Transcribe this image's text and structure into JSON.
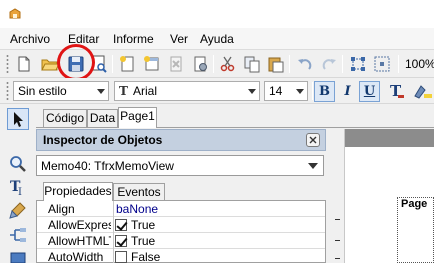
{
  "menu": [
    "Archivo",
    "Editar",
    "Informe",
    "Ver",
    "Ayuda"
  ],
  "toolbar": {
    "zoom": "100%",
    "style_combo": "Sin estilo",
    "font_combo": "Arial",
    "font_size": "14",
    "bold": "B",
    "italic": "I",
    "underline": "U"
  },
  "tabs": [
    "Código",
    "Data",
    "Page1"
  ],
  "inspector": {
    "title": "Inspector de Objetos",
    "object_selected": "Memo40: TfrxMemoView",
    "tabs": [
      "Propiedades",
      "Eventos"
    ],
    "properties": [
      {
        "name": "Align",
        "value": "baNone",
        "checkbox": null
      },
      {
        "name": "AllowExpressions",
        "value": "True",
        "checkbox": true
      },
      {
        "name": "AllowHTMLTags",
        "value": "True",
        "checkbox": true
      },
      {
        "name": "AutoWidth",
        "value": "False",
        "checkbox": false
      }
    ]
  },
  "designer": {
    "band_title": "Page"
  },
  "colors": {
    "highlight": "#e01414",
    "inspector_header": "#c4d0e0",
    "designer_background": "#8c8c8c"
  }
}
